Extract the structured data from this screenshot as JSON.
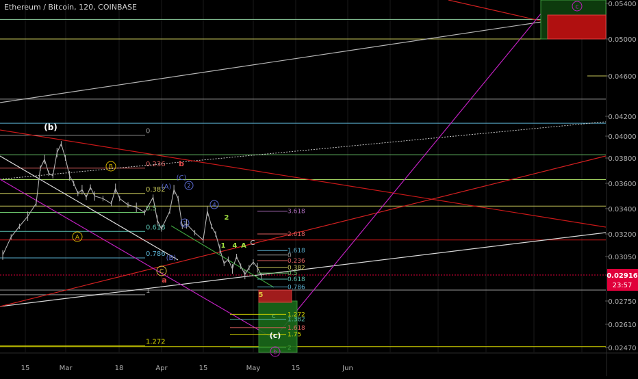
{
  "header": {
    "title": "Ethereum / Bitcoin, 120, COINBASE"
  },
  "colors": {
    "background": "#000000",
    "grid": "#1a1a1a",
    "candle": "#b4b4b4",
    "price_tag": "#e0003a",
    "magenta": "#c020c0",
    "red": "#d01818",
    "white_line": "#bdbdbd",
    "yellow": "#d4d400",
    "green": "#34b634",
    "cyan": "#2e8ab8"
  },
  "chart_data": {
    "type": "line",
    "title": "Ethereum / Bitcoin, 120, COINBASE",
    "xlabel": "",
    "ylabel": "",
    "x_tick_labels": [
      "15",
      "Mar",
      "18",
      "Apr",
      "15",
      "May",
      "15",
      "Jun"
    ],
    "y_tick_labels": [
      "0.05400",
      "0.05000",
      "0.04600",
      "0.04200",
      "0.04000",
      "0.03800",
      "0.03600",
      "0.03400",
      "0.03200",
      "0.03050",
      "0.02916",
      "0.02750",
      "0.02610",
      "0.02470"
    ],
    "ylim": [
      0.0245,
      0.0545
    ],
    "price_tag": {
      "value": "0.02916",
      "countdown": "23:57"
    },
    "price_series": {
      "name": "ETH/BTC",
      "points": [
        [
          0,
          0.0306
        ],
        [
          2,
          0.0318
        ],
        [
          4,
          0.0326
        ],
        [
          6,
          0.0334
        ],
        [
          8,
          0.0344
        ],
        [
          9,
          0.0372
        ],
        [
          10,
          0.0379
        ],
        [
          11,
          0.0368
        ],
        [
          12,
          0.0366
        ],
        [
          13,
          0.0385
        ],
        [
          14,
          0.0393
        ],
        [
          15,
          0.038
        ],
        [
          16,
          0.0366
        ],
        [
          17,
          0.036
        ],
        [
          18,
          0.0352
        ],
        [
          19,
          0.0355
        ],
        [
          20,
          0.0349
        ],
        [
          21,
          0.0357
        ],
        [
          22,
          0.035
        ],
        [
          24,
          0.0348
        ],
        [
          26,
          0.0344
        ],
        [
          27,
          0.0356
        ],
        [
          28,
          0.0348
        ],
        [
          30,
          0.0343
        ],
        [
          32,
          0.0341
        ],
        [
          34,
          0.0337
        ],
        [
          36,
          0.0349
        ],
        [
          37,
          0.0331
        ],
        [
          38,
          0.0324
        ],
        [
          40,
          0.0338
        ],
        [
          41,
          0.0355
        ],
        [
          42,
          0.0348
        ],
        [
          43,
          0.0326
        ],
        [
          44,
          0.0328
        ],
        [
          46,
          0.0321
        ],
        [
          48,
          0.0316
        ],
        [
          49,
          0.0338
        ],
        [
          50,
          0.0326
        ],
        [
          51,
          0.032
        ],
        [
          52,
          0.031
        ],
        [
          53,
          0.03
        ],
        [
          54,
          0.0303
        ],
        [
          55,
          0.0296
        ],
        [
          56,
          0.0305
        ],
        [
          57,
          0.0298
        ],
        [
          58,
          0.0292
        ],
        [
          59,
          0.0297
        ],
        [
          60,
          0.0301
        ],
        [
          61,
          0.0297
        ],
        [
          62,
          0.0291
        ]
      ]
    }
  },
  "annotations": {
    "wave_b_top": "(b)",
    "circle_A_left": "A",
    "circle_B": "B",
    "circle_C": "C",
    "label_a": "a",
    "label_b": "b",
    "wave_C_paren": "(C)",
    "wave_A_paren": "(A)",
    "wave_B_paren": "(B)",
    "circle_1": "1",
    "circle_2": "2",
    "circle_4": "4",
    "label_1": "1",
    "label_2": "2",
    "label_4": "4",
    "label_A": "A",
    "label_C": "C",
    "label_5": "5",
    "label_c_green": "c",
    "wave_c_target": "(c)",
    "circle_c_top": "c",
    "circle_b_bottom": "b"
  },
  "fib_labels": {
    "f0": "0",
    "f0236": "0.236",
    "f0382": "0.382",
    "f05": "0.5",
    "f0618": "0.618",
    "f0786": "0.786",
    "f1": "1",
    "f1272": "1.272",
    "e3618": "3.618",
    "e2618": "2.618",
    "e1618": "1.618",
    "e0": "0",
    "e0236": "0.236",
    "e0382": "0.382",
    "e05": "0.5",
    "e0618": "0.618",
    "e0786": "0.786",
    "t1272": "1.272",
    "t1382": "1.382",
    "t1618": "1.618",
    "t175": "1.75",
    "t2": "2"
  }
}
